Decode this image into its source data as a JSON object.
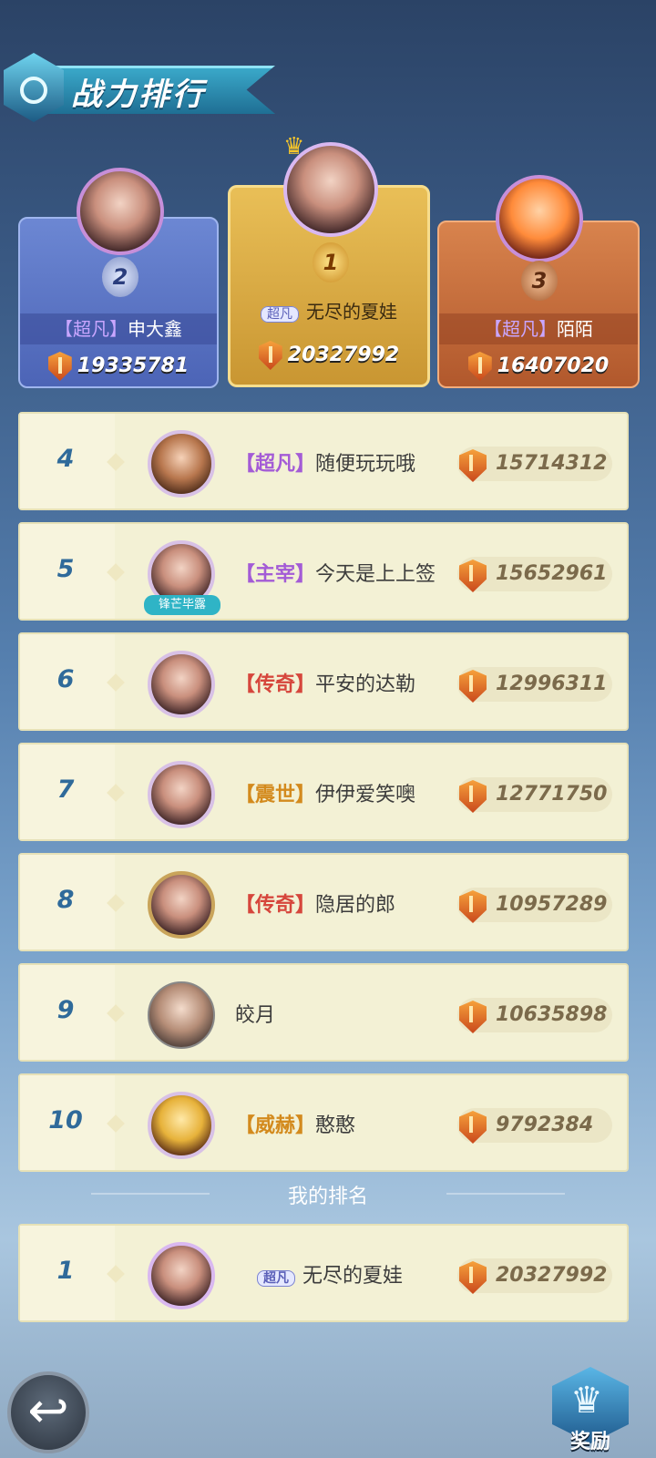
{
  "header": {
    "title": "战力排行"
  },
  "podium": [
    {
      "rank": "1",
      "title": "超凡",
      "name": "无尽的夏娃",
      "power": "20327992"
    },
    {
      "rank": "2",
      "title": "【超凡】",
      "name": "申大鑫",
      "power": "19335781"
    },
    {
      "rank": "3",
      "title": "【超凡】",
      "name": "陌陌",
      "power": "16407020"
    }
  ],
  "rows": [
    {
      "rank": "4",
      "title": "【超凡】",
      "name": "随便玩玩哦",
      "power": "15714312"
    },
    {
      "rank": "5",
      "title": "【主宰】",
      "name": "今天是上上签",
      "power": "15652961",
      "badge": "锋芒毕露"
    },
    {
      "rank": "6",
      "title": "【传奇】",
      "name": "平安的达勒",
      "power": "12996311"
    },
    {
      "rank": "7",
      "title": "【震世】",
      "name": "伊伊爱笑噢",
      "power": "12771750"
    },
    {
      "rank": "8",
      "title": "【传奇】",
      "name": "隐居的郎",
      "power": "10957289"
    },
    {
      "rank": "9",
      "title": "",
      "name": "皎月",
      "power": "10635898"
    },
    {
      "rank": "10",
      "title": "【威赫】",
      "name": "憨憨",
      "power": "9792384"
    }
  ],
  "my_rank": {
    "section_title": "我的排名",
    "rank": "1",
    "title": "超凡",
    "name": "无尽的夏娃",
    "power": "20327992"
  },
  "buttons": {
    "reward_label": "奖励"
  },
  "colors": {
    "accent": "#2f6a9a",
    "gold": "#e9bf57",
    "silver": "#6c87d3",
    "bronze": "#d8834d"
  },
  "icons": {
    "back": "back-arrow-icon",
    "reward": "crown-icon",
    "power": "power-shield-icon"
  }
}
